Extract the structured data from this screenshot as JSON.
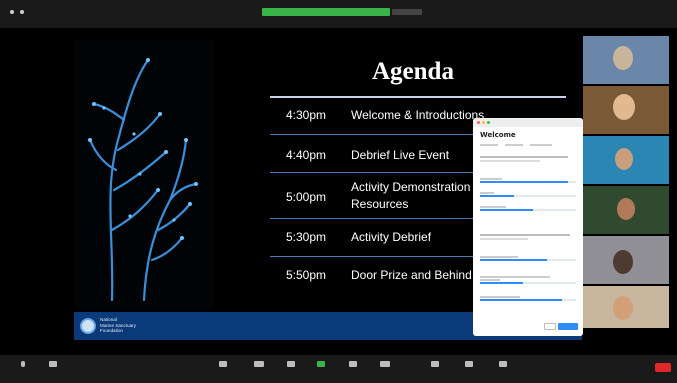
{
  "topbar": {
    "meeting_name": "",
    "share_banner": "",
    "share_option": "",
    "view_label": ""
  },
  "slide": {
    "title": "Agenda",
    "items": [
      {
        "time": "4:30pm",
        "text": "Welcome & Introductions"
      },
      {
        "time": "4:40pm",
        "text": "Debrief Live Event"
      },
      {
        "time": "5:00pm",
        "text": "Activity Demonstration",
        "text2": "Resources"
      },
      {
        "time": "5:30pm",
        "text": "Activity Debrief"
      },
      {
        "time": "5:50pm",
        "text": "Door Prize and Behind"
      }
    ],
    "footer_org": [
      "National",
      "Marine Sanctuary",
      "Foundation"
    ]
  },
  "poll": {
    "heading": "Welcome",
    "options": [
      {
        "fill": 0.92
      },
      {
        "fill": 0.35
      },
      {
        "fill": 0.55
      },
      {
        "fill": 0.7
      },
      {
        "fill": 0.45
      },
      {
        "fill": 0.85
      }
    ]
  },
  "gallery": {
    "participants": [
      {
        "name": "",
        "bg": "#6a86a9",
        "face": "#c9b49c"
      },
      {
        "name": "",
        "bg": "#7a5a36",
        "face": "#e2b98f"
      },
      {
        "name": "",
        "bg": "#2c86b3",
        "face": "#c99e7d"
      },
      {
        "name": "",
        "bg": "#2f4a2e",
        "face": "#b07b5a"
      },
      {
        "name": "",
        "bg": "#8f8f95",
        "face": "#4d3a30"
      },
      {
        "name": "",
        "bg": "#c9b69f",
        "face": "#d3a07a"
      }
    ]
  },
  "colors": {
    "accent": "#2d8cff",
    "banner": "#39b54a",
    "slide_footer": "#0b3a7a",
    "end": "#e02828"
  },
  "toolbar": {
    "end_label": ""
  }
}
